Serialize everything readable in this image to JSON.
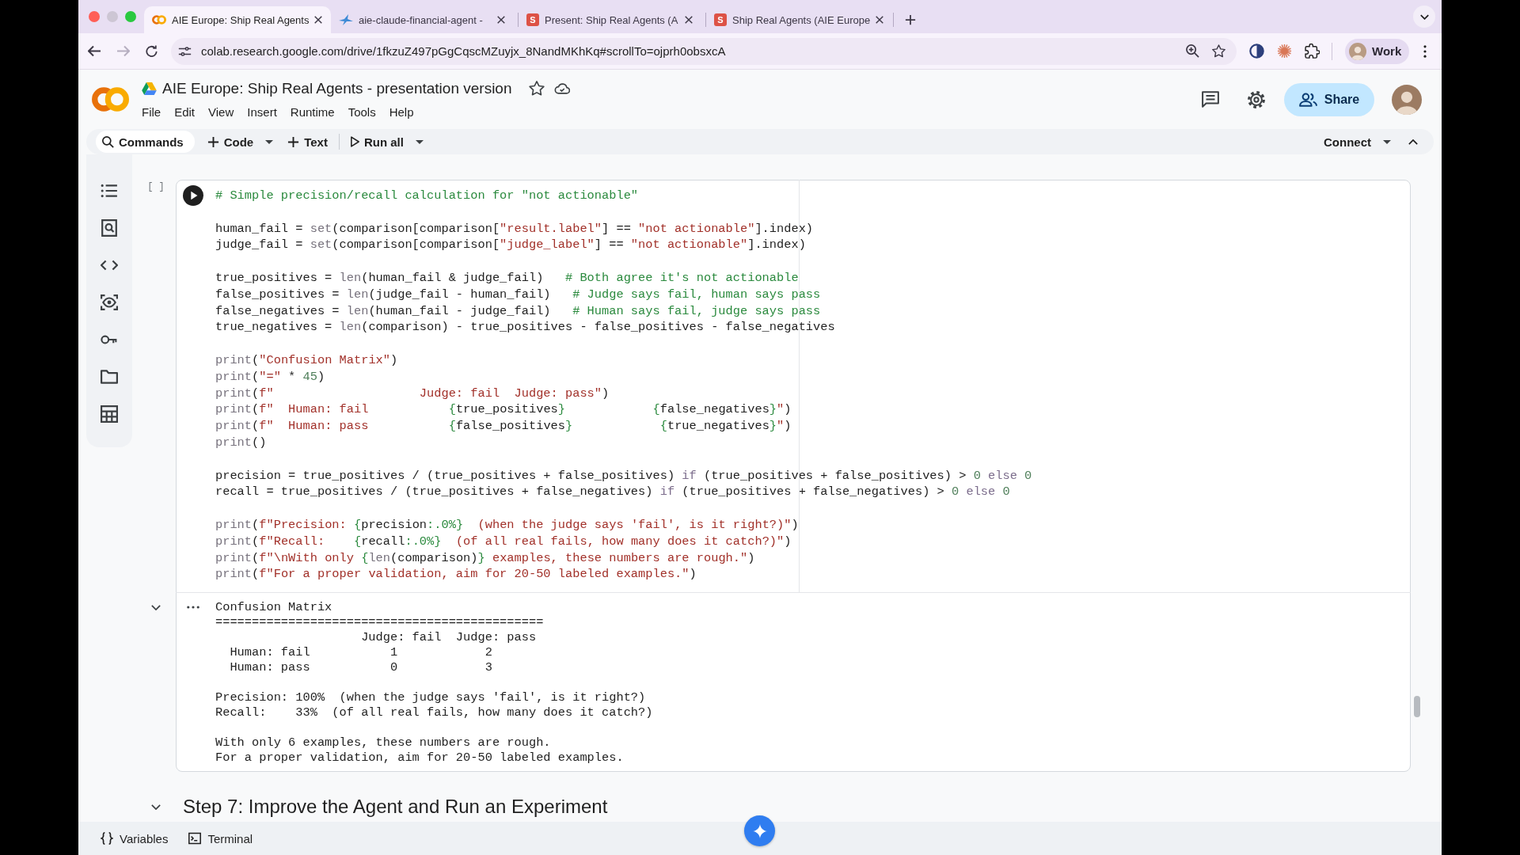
{
  "browser": {
    "tabs": [
      {
        "favicon": {
          "kind": "logo"
        },
        "title": "AIE Europe: Ship Real Agents",
        "selected": true
      },
      {
        "favicon": {
          "kind": "bird"
        },
        "title": "aie-claude-financial-agent -",
        "selected": false
      },
      {
        "favicon": {
          "kind": "letter",
          "letter": "S"
        },
        "title": "Present: Ship Real Agents (A",
        "selected": false
      },
      {
        "favicon": {
          "kind": "letter",
          "letter": "S"
        },
        "title": "Ship Real Agents (AIE Europe",
        "selected": false
      }
    ],
    "forward": {
      "disabled": true
    },
    "url": "colab.research.google.com/drive/1fkzuZ497pGgCqscMZuyjx_8NandMKhKq#scrollTo=ojprh0obsxcA",
    "profile": "Work"
  },
  "notebook": {
    "title": "AIE Europe: Ship Real Agents - presentation version",
    "menu": [
      "File",
      "Edit",
      "View",
      "Insert",
      "Runtime",
      "Tools",
      "Help"
    ],
    "share": "Share"
  },
  "toolbar": {
    "commands": "Commands",
    "add_code": "Code",
    "add_text": "Text",
    "run_all": "Run all",
    "connect": "Connect"
  },
  "cell": {
    "bracket": "[ ]",
    "code_blocks": [
      [
        {
          "tokens": [
            {
              "kind": "comment",
              "text": "# Simple precision/recall calculation for \"not actionable\""
            }
          ]
        }
      ],
      [
        {
          "tokens": [
            {
              "kind": "plain",
              "text": "human_fail = "
            },
            {
              "kind": "builtin",
              "text": "set"
            },
            {
              "kind": "plain",
              "text": "(comparison[comparison["
            },
            {
              "kind": "string",
              "text": "\"result.label\""
            },
            {
              "kind": "plain",
              "text": "] == "
            },
            {
              "kind": "string",
              "text": "\"not actionable\""
            },
            {
              "kind": "plain",
              "text": "].index)"
            }
          ]
        },
        {
          "tokens": [
            {
              "kind": "plain",
              "text": "judge_fail = "
            },
            {
              "kind": "builtin",
              "text": "set"
            },
            {
              "kind": "plain",
              "text": "(comparison[comparison["
            },
            {
              "kind": "string",
              "text": "\"judge_label\""
            },
            {
              "kind": "plain",
              "text": "] == "
            },
            {
              "kind": "string",
              "text": "\"not actionable\""
            },
            {
              "kind": "plain",
              "text": "].index)"
            }
          ]
        }
      ],
      [
        {
          "tokens": [
            {
              "kind": "plain",
              "text": "true_positives = "
            },
            {
              "kind": "builtin",
              "text": "len"
            },
            {
              "kind": "plain",
              "text": "(human_fail & judge_fail)   "
            },
            {
              "kind": "comment",
              "text": "# Both agree it's not actionable"
            }
          ]
        },
        {
          "tokens": [
            {
              "kind": "plain",
              "text": "false_positives = "
            },
            {
              "kind": "builtin",
              "text": "len"
            },
            {
              "kind": "plain",
              "text": "(judge_fail - human_fail)   "
            },
            {
              "kind": "comment",
              "text": "# Judge says fail, human says pass"
            }
          ]
        },
        {
          "tokens": [
            {
              "kind": "plain",
              "text": "false_negatives = "
            },
            {
              "kind": "builtin",
              "text": "len"
            },
            {
              "kind": "plain",
              "text": "(human_fail - judge_fail)   "
            },
            {
              "kind": "comment",
              "text": "# Human says fail, judge says pass"
            }
          ]
        },
        {
          "tokens": [
            {
              "kind": "plain",
              "text": "true_negatives = "
            },
            {
              "kind": "builtin",
              "text": "len"
            },
            {
              "kind": "plain",
              "text": "(comparison) - true_positives - false_positives - false_negatives"
            }
          ]
        }
      ],
      [
        {
          "tokens": [
            {
              "kind": "function",
              "text": "print"
            },
            {
              "kind": "plain",
              "text": "("
            },
            {
              "kind": "string",
              "text": "\"Confusion Matrix\""
            },
            {
              "kind": "plain",
              "text": ")"
            }
          ]
        },
        {
          "tokens": [
            {
              "kind": "function",
              "text": "print"
            },
            {
              "kind": "plain",
              "text": "("
            },
            {
              "kind": "string",
              "text": "\"=\""
            },
            {
              "kind": "plain",
              "text": " * "
            },
            {
              "kind": "number",
              "text": "45"
            },
            {
              "kind": "plain",
              "text": ")"
            }
          ]
        },
        {
          "tokens": [
            {
              "kind": "function",
              "text": "print"
            },
            {
              "kind": "plain",
              "text": "("
            },
            {
              "kind": "string",
              "text": "f\"                    Judge: fail  Judge: pass\""
            },
            {
              "kind": "plain",
              "text": ")"
            }
          ]
        },
        {
          "tokens": [
            {
              "kind": "function",
              "text": "print"
            },
            {
              "kind": "plain",
              "text": "("
            },
            {
              "kind": "string",
              "text": "f\"  Human: fail           "
            },
            {
              "kind": "interp",
              "text": "{"
            },
            {
              "kind": "plain",
              "text": "true_positives"
            },
            {
              "kind": "interp",
              "text": "}            {"
            },
            {
              "kind": "plain",
              "text": "false_negatives"
            },
            {
              "kind": "interp",
              "text": "}"
            },
            {
              "kind": "string",
              "text": "\""
            },
            {
              "kind": "plain",
              "text": ")"
            }
          ]
        },
        {
          "tokens": [
            {
              "kind": "function",
              "text": "print"
            },
            {
              "kind": "plain",
              "text": "("
            },
            {
              "kind": "string",
              "text": "f\"  Human: pass           "
            },
            {
              "kind": "interp",
              "text": "{"
            },
            {
              "kind": "plain",
              "text": "false_positives"
            },
            {
              "kind": "interp",
              "text": "}            {"
            },
            {
              "kind": "plain",
              "text": "true_negatives"
            },
            {
              "kind": "interp",
              "text": "}"
            },
            {
              "kind": "string",
              "text": "\""
            },
            {
              "kind": "plain",
              "text": ")"
            }
          ]
        },
        {
          "tokens": [
            {
              "kind": "function",
              "text": "print"
            },
            {
              "kind": "plain",
              "text": "()"
            }
          ]
        }
      ],
      [
        {
          "tokens": [
            {
              "kind": "plain",
              "text": "precision = true_positives / (true_positives + false_positives) "
            },
            {
              "kind": "keyword",
              "text": "if"
            },
            {
              "kind": "plain",
              "text": " (true_positives + false_positives) > "
            },
            {
              "kind": "number",
              "text": "0"
            },
            {
              "kind": "keyword",
              "text": " else "
            },
            {
              "kind": "number",
              "text": "0"
            }
          ]
        },
        {
          "tokens": [
            {
              "kind": "plain",
              "text": "recall = true_positives / (true_positives + false_negatives) "
            },
            {
              "kind": "keyword",
              "text": "if"
            },
            {
              "kind": "plain",
              "text": " (true_positives + false_negatives) > "
            },
            {
              "kind": "number",
              "text": "0"
            },
            {
              "kind": "keyword",
              "text": " else "
            },
            {
              "kind": "number",
              "text": "0"
            }
          ]
        }
      ],
      [
        {
          "tokens": [
            {
              "kind": "function",
              "text": "print"
            },
            {
              "kind": "plain",
              "text": "("
            },
            {
              "kind": "string",
              "text": "f\"Precision: "
            },
            {
              "kind": "interp",
              "text": "{"
            },
            {
              "kind": "plain",
              "text": "precision"
            },
            {
              "kind": "interp",
              "text": ":.0%}"
            },
            {
              "kind": "string",
              "text": "  (when the judge says 'fail', is it right?)\""
            },
            {
              "kind": "plain",
              "text": ")"
            }
          ]
        },
        {
          "tokens": [
            {
              "kind": "function",
              "text": "print"
            },
            {
              "kind": "plain",
              "text": "("
            },
            {
              "kind": "string",
              "text": "f\"Recall:    "
            },
            {
              "kind": "interp",
              "text": "{"
            },
            {
              "kind": "plain",
              "text": "recall"
            },
            {
              "kind": "interp",
              "text": ":.0%}"
            },
            {
              "kind": "string",
              "text": "  (of all real fails, how many does it catch?)\""
            },
            {
              "kind": "plain",
              "text": ")"
            }
          ]
        },
        {
          "tokens": [
            {
              "kind": "function",
              "text": "print"
            },
            {
              "kind": "plain",
              "text": "("
            },
            {
              "kind": "string",
              "text": "f\"\\nWith only "
            },
            {
              "kind": "interp",
              "text": "{"
            },
            {
              "kind": "builtin",
              "text": "len"
            },
            {
              "kind": "plain",
              "text": "(comparison)"
            },
            {
              "kind": "interp",
              "text": "}"
            },
            {
              "kind": "string",
              "text": " examples, these numbers are rough.\""
            },
            {
              "kind": "plain",
              "text": ")"
            }
          ]
        },
        {
          "tokens": [
            {
              "kind": "function",
              "text": "print"
            },
            {
              "kind": "plain",
              "text": "("
            },
            {
              "kind": "string",
              "text": "f\"For a proper validation, aim for 20-50 labeled examples.\""
            },
            {
              "kind": "plain",
              "text": ")"
            }
          ]
        }
      ]
    ],
    "output": {
      "expanded": true,
      "blocks": [
        [
          "Confusion Matrix",
          "=============================================",
          "                    Judge: fail  Judge: pass",
          "  Human: fail           1            2",
          "  Human: pass           0            3"
        ],
        [
          "Precision: 100%  (when the judge says 'fail', is it right?)",
          "Recall:    33%  (of all real fails, how many does it catch?)"
        ],
        [
          "With only 6 examples, these numbers are rough.",
          "For a proper validation, aim for 20-50 labeled examples."
        ]
      ]
    }
  },
  "section": {
    "expanded": true,
    "heading": "Step 7: Improve the Agent and Run an Experiment"
  },
  "bottom_bar": {
    "variables": "Variables",
    "terminal": "Terminal"
  }
}
